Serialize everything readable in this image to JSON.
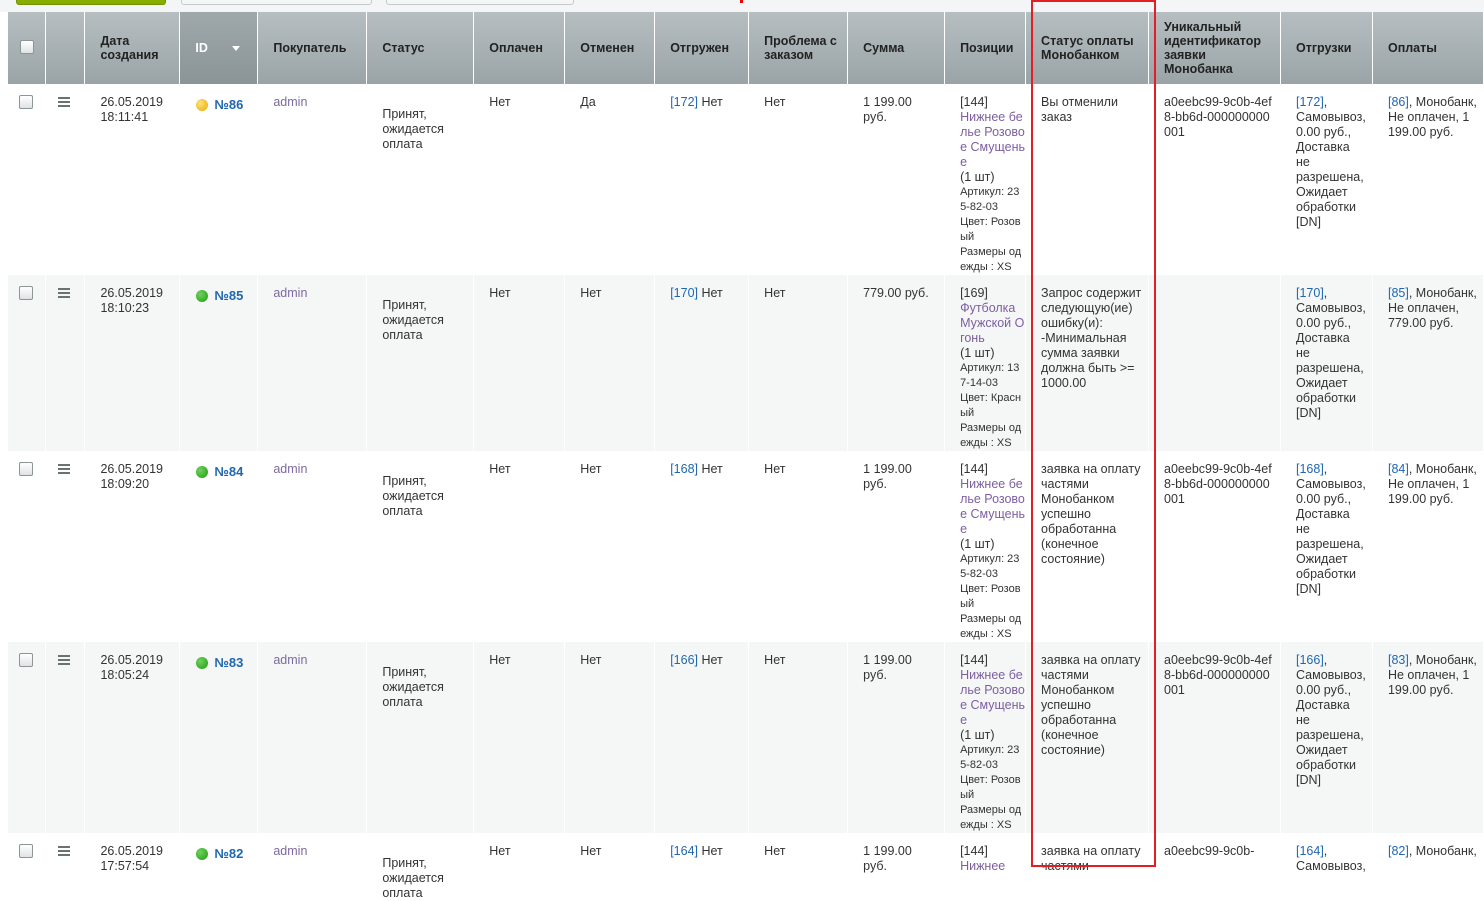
{
  "headers": {
    "created": "Дата создания",
    "id": "ID",
    "buyer": "Покупатель",
    "status": "Статус",
    "paid": "Оплачен",
    "cancelled": "Отменен",
    "shipped": "Отгружен",
    "problem": "Проблема с заказом",
    "sum": "Сумма",
    "positions": "Позиции",
    "mono_status": "Статус оплаты Монобанком",
    "mono_id": "Уникальный идентификатор заявки Монобанка",
    "shipments": "Отгрузки",
    "payments": "Оплаты"
  },
  "rows": [
    {
      "date": "26.05.2019",
      "time": "18:11:41",
      "dot": "yellow",
      "id": "№86",
      "buyer": "admin",
      "status": "Принят, ожидается оплата",
      "paid": "Нет",
      "cancelled": "Да",
      "ship_id": "[172]",
      "ship_val": " Нет",
      "problem": "Нет",
      "sum": "1 199.00 руб.",
      "pos_code": "[144]",
      "pos_name": "Нижнее белье Розовое Смущенье",
      "pos_qty": "(1 шт)",
      "pos_art": "Артикул: 235-82-03",
      "pos_color": "Цвет: Розовый",
      "pos_size": "Размеры одежды : XS",
      "mono_status": "Вы отменили заказ",
      "mono_id": "a0eebc99-9c0b-4ef8-bb6d-000000000001",
      "shipment_link": "[172]",
      "shipment_text": ", Самовывоз, 0.00 руб., Доставка не разрешена, Ожидает обработки [DN]",
      "payment_link": "[86]",
      "payment_text": ", Монобанк, Не оплачен, 1 199.00 руб."
    },
    {
      "date": "26.05.2019",
      "time": "18:10:23",
      "dot": "green",
      "id": "№85",
      "buyer": "admin",
      "status": "Принят, ожидается оплата",
      "paid": "Нет",
      "cancelled": "Нет",
      "ship_id": "[170]",
      "ship_val": " Нет",
      "problem": "Нет",
      "sum": "779.00 руб.",
      "pos_code": "[169]",
      "pos_name": "Футболка Мужской Огонь",
      "pos_qty": "(1 шт)",
      "pos_art": "Артикул: 137-14-03",
      "pos_color": "Цвет: Красный",
      "pos_size": "Размеры одежды : XS",
      "mono_status": "Запрос содержит следующую(ие) ошибку(и): -Минимальная сумма заявки должна быть >= 1000.00",
      "mono_id": "",
      "shipment_link": "[170]",
      "shipment_text": ", Самовывоз, 0.00 руб., Доставка не разрешена, Ожидает обработки [DN]",
      "payment_link": "[85]",
      "payment_text": ", Монобанк, Не оплачен, 779.00 руб."
    },
    {
      "date": "26.05.2019",
      "time": "18:09:20",
      "dot": "green",
      "id": "№84",
      "buyer": "admin",
      "status": "Принят, ожидается оплата",
      "paid": "Нет",
      "cancelled": "Нет",
      "ship_id": "[168]",
      "ship_val": " Нет",
      "problem": "Нет",
      "sum": "1 199.00 руб.",
      "pos_code": "[144]",
      "pos_name": "Нижнее белье Розовое Смущенье",
      "pos_qty": "(1 шт)",
      "pos_art": "Артикул: 235-82-03",
      "pos_color": "Цвет: Розовый",
      "pos_size": "Размеры одежды : XS",
      "mono_status": "заявка на оплату частями Монобанком успешно обработанна (конечное состояние)",
      "mono_id": "a0eebc99-9c0b-4ef8-bb6d-000000000001",
      "shipment_link": "[168]",
      "shipment_text": ", Самовывоз, 0.00 руб., Доставка не разрешена, Ожидает обработки [DN]",
      "payment_link": "[84]",
      "payment_text": ", Монобанк, Не оплачен, 1 199.00 руб."
    },
    {
      "date": "26.05.2019",
      "time": "18:05:24",
      "dot": "green",
      "id": "№83",
      "buyer": "admin",
      "status": "Принят, ожидается оплата",
      "paid": "Нет",
      "cancelled": "Нет",
      "ship_id": "[166]",
      "ship_val": " Нет",
      "problem": "Нет",
      "sum": "1 199.00 руб.",
      "pos_code": "[144]",
      "pos_name": "Нижнее белье Розовое Смущенье",
      "pos_qty": "(1 шт)",
      "pos_art": "Артикул: 235-82-03",
      "pos_color": "Цвет: Розовый",
      "pos_size": "Размеры одежды : XS",
      "mono_status": "заявка на оплату частями Монобанком успешно обработанна (конечное состояние)",
      "mono_id": "a0eebc99-9c0b-4ef8-bb6d-000000000001",
      "shipment_link": "[166]",
      "shipment_text": ", Самовывоз, 0.00 руб., Доставка не разрешена, Ожидает обработки [DN]",
      "payment_link": "[83]",
      "payment_text": ", Монобанк, Не оплачен, 1 199.00 руб."
    },
    {
      "date": "26.05.2019",
      "time": "17:57:54",
      "dot": "green",
      "id": "№82",
      "buyer": "admin",
      "status": "Принят, ожидается оплата",
      "paid": "Нет",
      "cancelled": "Нет",
      "ship_id": "[164]",
      "ship_val": " Нет",
      "problem": "Нет",
      "sum": "1 199.00 руб.",
      "pos_code": "[144]",
      "pos_name": "Нижнее",
      "pos_qty": "",
      "pos_art": "",
      "pos_color": "",
      "pos_size": "",
      "mono_status": "заявка на оплату частями",
      "mono_id": "a0eebc99-9c0b-",
      "shipment_link": "[164]",
      "shipment_text": ", Самовывоз,",
      "payment_link": "[82]",
      "payment_text": ", Монобанк,"
    }
  ],
  "colors": {
    "header_bg": "#a8b1b4",
    "link": "#2067b0",
    "product_link": "#7d5fa0",
    "highlight": "#e31e24"
  },
  "icons": {
    "row_menu": "hamburger-icon",
    "sort": "sort-desc-icon",
    "status_dot": "status-dot-icon"
  }
}
